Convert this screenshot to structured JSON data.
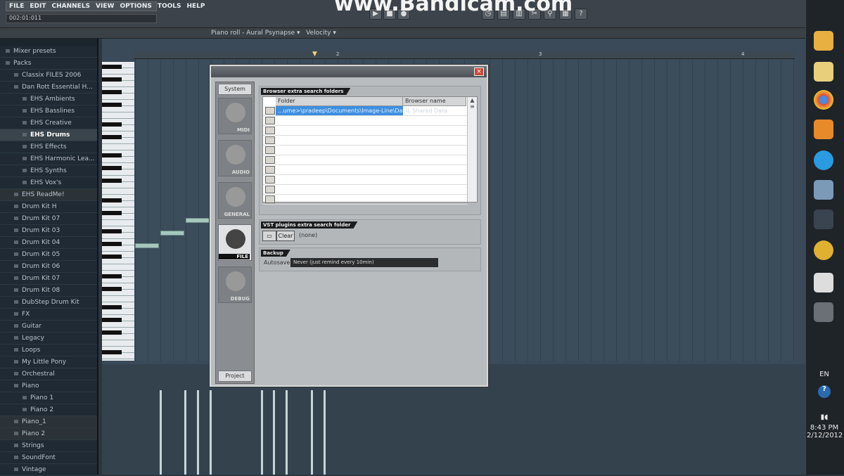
{
  "menu": [
    "FILE",
    "EDIT",
    "CHANNELS",
    "VIEW",
    "OPTIONS",
    "TOOLS",
    "HELP"
  ],
  "hint": "002:01:011",
  "watermark": "www.Bandicam.com",
  "piano_roll_title": "Piano roll - Aural Psynapse",
  "piano_roll_target": "Velocity",
  "ruler": [
    "2",
    "3",
    "4"
  ],
  "browser": [
    {
      "label": "Mixer presets",
      "level": 0
    },
    {
      "label": "Packs",
      "level": 0
    },
    {
      "label": "Classix FILES 2006",
      "level": 1
    },
    {
      "label": "Dan Rott Essential H...",
      "level": 1
    },
    {
      "label": "EHS Ambients",
      "level": 2
    },
    {
      "label": "EHS Basslines",
      "level": 2
    },
    {
      "label": "EHS Creative",
      "level": 2
    },
    {
      "label": "EHS Drums",
      "level": 2,
      "selected": true
    },
    {
      "label": "EHS Effects",
      "level": 2
    },
    {
      "label": "EHS Harmonic Lea...",
      "level": 2
    },
    {
      "label": "EHS Synths",
      "level": 2
    },
    {
      "label": "EHS Vox's",
      "level": 2
    },
    {
      "label": "EHS ReadMe!",
      "level": 1,
      "file": true
    },
    {
      "label": "Drum Kit H",
      "level": 1
    },
    {
      "label": "Drum Kit 07",
      "level": 1
    },
    {
      "label": "Drum Kit 03",
      "level": 1
    },
    {
      "label": "Drum Kit 04",
      "level": 1
    },
    {
      "label": "Drum Kit 05",
      "level": 1
    },
    {
      "label": "Drum Kit 06",
      "level": 1
    },
    {
      "label": "Drum Kit 07",
      "level": 1
    },
    {
      "label": "Drum Kit 08",
      "level": 1
    },
    {
      "label": "DubStep Drum Kit",
      "level": 1
    },
    {
      "label": "FX",
      "level": 1
    },
    {
      "label": "Guitar",
      "level": 1
    },
    {
      "label": "Legacy",
      "level": 1
    },
    {
      "label": "Loops",
      "level": 1
    },
    {
      "label": "My Little Pony",
      "level": 1
    },
    {
      "label": "Orchestral",
      "level": 1
    },
    {
      "label": "Piano",
      "level": 1
    },
    {
      "label": "Piano 1",
      "level": 2
    },
    {
      "label": "Piano 2",
      "level": 2
    },
    {
      "label": "Piano_1",
      "level": 1,
      "file": true
    },
    {
      "label": "Piano 2",
      "level": 1,
      "file": true
    },
    {
      "label": "Strings",
      "level": 1
    },
    {
      "label": "SoundFont",
      "level": 1
    },
    {
      "label": "Vintage",
      "level": 1
    }
  ],
  "dialog": {
    "close": "×",
    "system": "System",
    "project": "Project",
    "categories": [
      "MIDI",
      "AUDIO",
      "GENERAL",
      "FILE",
      "DEBUG"
    ],
    "active_category": "FILE",
    "browser_section": "Browser extra search folders",
    "columns": [
      "Folder",
      "Browser name"
    ],
    "rows": [
      {
        "folder": "...ume>\\pradeep\\Documents\\Image-Line\\Data",
        "name": "IL Shared Data"
      }
    ],
    "empty_rows": 9,
    "vst_section": "VST plugins extra search folder",
    "clear": "Clear",
    "vst_value": "(none)",
    "backup_section": "Backup",
    "autosave_label": "Autosave",
    "autosave_value": "Never (just remind every 10min)"
  },
  "tray": {
    "lang": "EN",
    "time": "8:43 PM",
    "date": "2/12/2012"
  }
}
